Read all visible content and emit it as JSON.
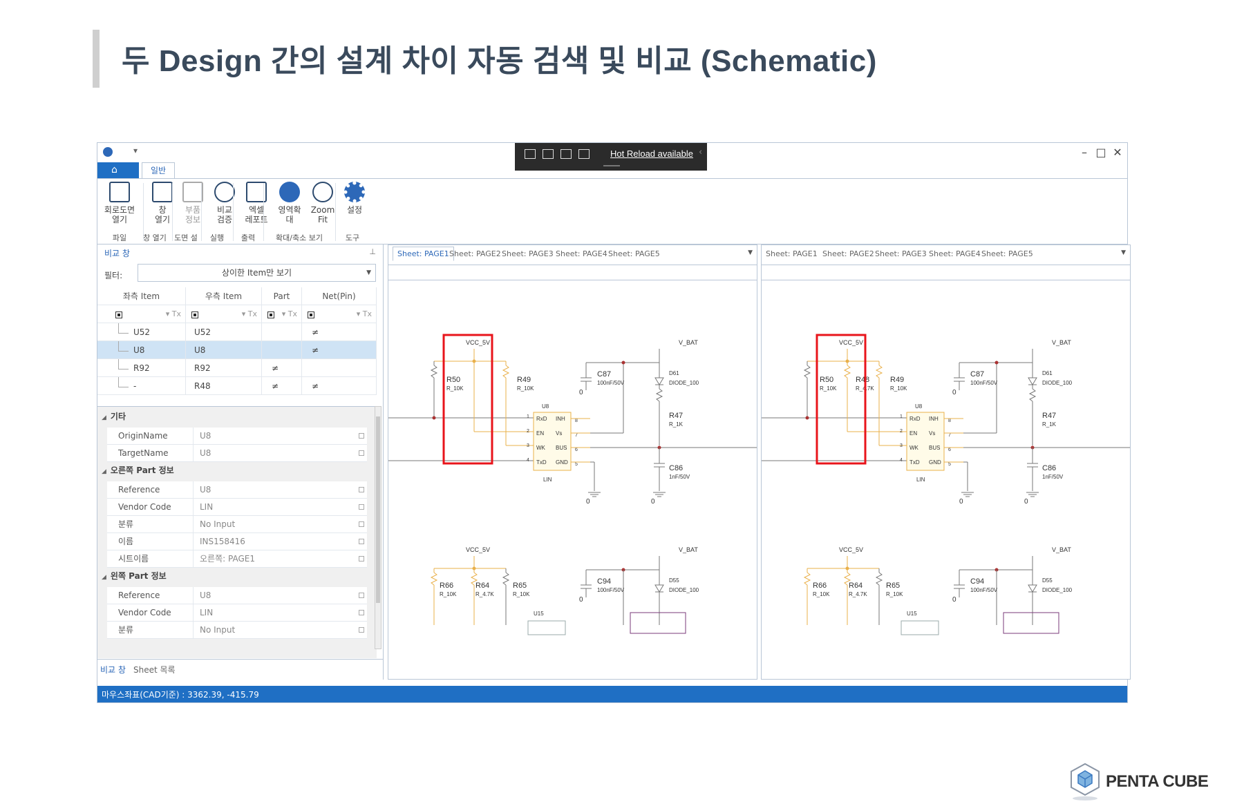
{
  "slide": {
    "title": "두  Design  간의 설계 차이 자동 검색 및 비교  (Schematic)",
    "brand": "PENTA CUBE"
  },
  "app": {
    "hot_reload": "Hot Reload available",
    "tabs": {
      "home_icon": "home-icon",
      "general": "일반"
    },
    "ribbon": {
      "buttons": [
        {
          "label": "회로도면\n열기",
          "icon": "open-schematic-icon"
        },
        {
          "label": "창\n열기",
          "icon": "window-icon"
        },
        {
          "label": "부품\n정보",
          "icon": "part-info-icon",
          "disabled": true
        },
        {
          "label": "비교\n검증",
          "icon": "play-icon"
        },
        {
          "label": "엑셀\n레포트",
          "icon": "excel-icon"
        },
        {
          "label": "영역확대",
          "icon": "zoom-area-icon"
        },
        {
          "label": "Zoom\nFit",
          "icon": "zoom-fit-icon"
        },
        {
          "label": "설정",
          "icon": "gear-icon"
        }
      ],
      "groups": [
        "파일",
        "창 열기",
        "도면 설정",
        "실행",
        "출력",
        "확대/축소 보기",
        "도구"
      ]
    },
    "compare_panel": {
      "title": "비교 창",
      "filter_label": "필터:",
      "filter_value": "상이한 Item만 보기",
      "columns": [
        "좌측 Item",
        "우측 Item",
        "Part",
        "Net(Pin)"
      ],
      "rows": [
        {
          "left": "U52",
          "right": "U52",
          "part": "",
          "net": "≠",
          "selected": false
        },
        {
          "left": "U8",
          "right": "U8",
          "part": "",
          "net": "≠",
          "selected": true
        },
        {
          "left": "R92",
          "right": "R92",
          "part": "≠",
          "net": "",
          "selected": false
        },
        {
          "left": "-",
          "right": "R48",
          "part": "≠",
          "net": "≠",
          "selected": false
        }
      ]
    },
    "properties": {
      "sections": [
        {
          "name": "기타",
          "rows": [
            {
              "name": "OriginName",
              "value": "U8"
            },
            {
              "name": "TargetName",
              "value": "U8"
            }
          ]
        },
        {
          "name": "오른쪽 Part 정보",
          "rows": [
            {
              "name": "Reference",
              "value": "U8"
            },
            {
              "name": "Vendor Code",
              "value": "LIN"
            },
            {
              "name": "분류",
              "value": "No Input"
            },
            {
              "name": "이름",
              "value": "INS158416"
            },
            {
              "name": "시트이름",
              "value": "오른쪽: PAGE1"
            }
          ]
        },
        {
          "name": "왼쪽 Part 정보",
          "rows": [
            {
              "name": "Reference",
              "value": "U8"
            },
            {
              "name": "Vendor Code",
              "value": "LIN"
            },
            {
              "name": "분류",
              "value": "No Input"
            }
          ]
        }
      ]
    },
    "bottom_tabs": [
      "비교 창",
      "Sheet 목록"
    ],
    "sheets": [
      "Sheet: PAGE1",
      "Sheet: PAGE2",
      "Sheet: PAGE3",
      "Sheet: PAGE4",
      "Sheet: PAGE5"
    ],
    "schematic": {
      "vcc": "VCC_5V",
      "vbat": "V_BAT",
      "left_resistors_top": [
        {
          "ref": "R50",
          "val": "R_10K"
        },
        {
          "ref": "R49",
          "val": "R_10K"
        }
      ],
      "right_resistors_top": [
        {
          "ref": "R50",
          "val": "R_10K"
        },
        {
          "ref": "R48",
          "val": "R_4.7K"
        },
        {
          "ref": "R49",
          "val": "R_10K"
        }
      ],
      "c87": {
        "ref": "C87",
        "val": "100nF/50V"
      },
      "d61": {
        "ref": "D61",
        "val": "DIODE_100"
      },
      "r47": {
        "ref": "R47",
        "val": "R_1K"
      },
      "c86": {
        "ref": "C86",
        "val": "1nF/50V"
      },
      "u8": {
        "ref": "U8",
        "pins_left": [
          "RxD",
          "EN",
          "WK",
          "TxD"
        ],
        "pins_right": [
          "INH",
          "Vs",
          "BUS",
          "GND"
        ],
        "nums_left": [
          "1",
          "2",
          "3",
          "4"
        ],
        "nums_right": [
          "8",
          "7",
          "6",
          "5"
        ],
        "part": "LIN"
      },
      "ground": "0",
      "bottom_resistors": [
        {
          "ref": "R66",
          "val": "R_10K"
        },
        {
          "ref": "R64",
          "val": "R_4.7K"
        },
        {
          "ref": "R65",
          "val": "R_10K"
        }
      ],
      "c94": {
        "ref": "C94",
        "val": "100nF/50V"
      },
      "d55": {
        "ref": "D55",
        "val": "DIODE_100"
      },
      "u15": "U15"
    },
    "status": "마우스좌표(CAD기준) : 3362.39, -415.79"
  }
}
